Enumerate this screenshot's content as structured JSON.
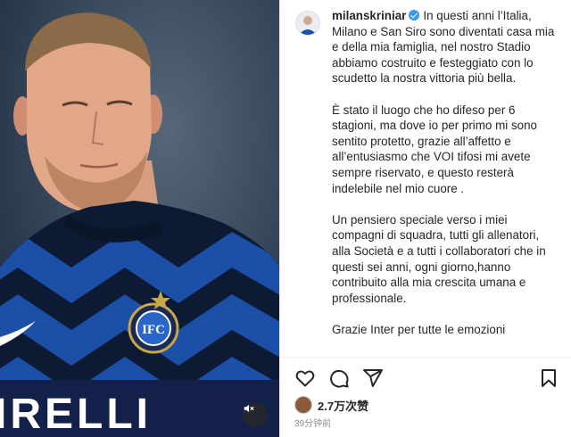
{
  "post": {
    "username": "milanskriniar",
    "paragraphs": [
      "In questi anni l’Italia, Milano e San Siro sono diventati casa mia e della mia famiglia, nel nostro Stadio abbiamo costruito e festeggiato con lo scudetto la nostra vittoria più bella.",
      "È stato il luogo che ho difeso per 6 stagioni, ma dove io per primo mi sono sentito protetto, grazie all’affetto e all’entusiasmo che VOI tifosi mi avete sempre riservato, e questo resterà indelebile nel mio cuore .",
      "Un pensiero speciale verso i miei compagni di squadra, tutti gli allenatori, alla Società e a tutti i collaboratori che in questi sei anni, ogni giorno,hanno contribuito alla mia crescita umana e professionale.",
      "Grazie Inter per tutte le emozioni"
    ],
    "likes": "2.7万次赞",
    "time_ago": "39分钟前"
  },
  "photo": {
    "sponsor_text": "IRELLI"
  },
  "icons": {
    "like": "heart-icon",
    "comment": "comment-icon",
    "share": "share-icon",
    "save": "bookmark-icon",
    "mute": "muted-speaker-icon",
    "verified": "verified-badge-icon"
  },
  "colors": {
    "jersey_blue": "#1c4fa8",
    "jersey_black": "#0d1a33",
    "verified_blue": "#3897f0",
    "muted_text": "#8e8e8e"
  }
}
